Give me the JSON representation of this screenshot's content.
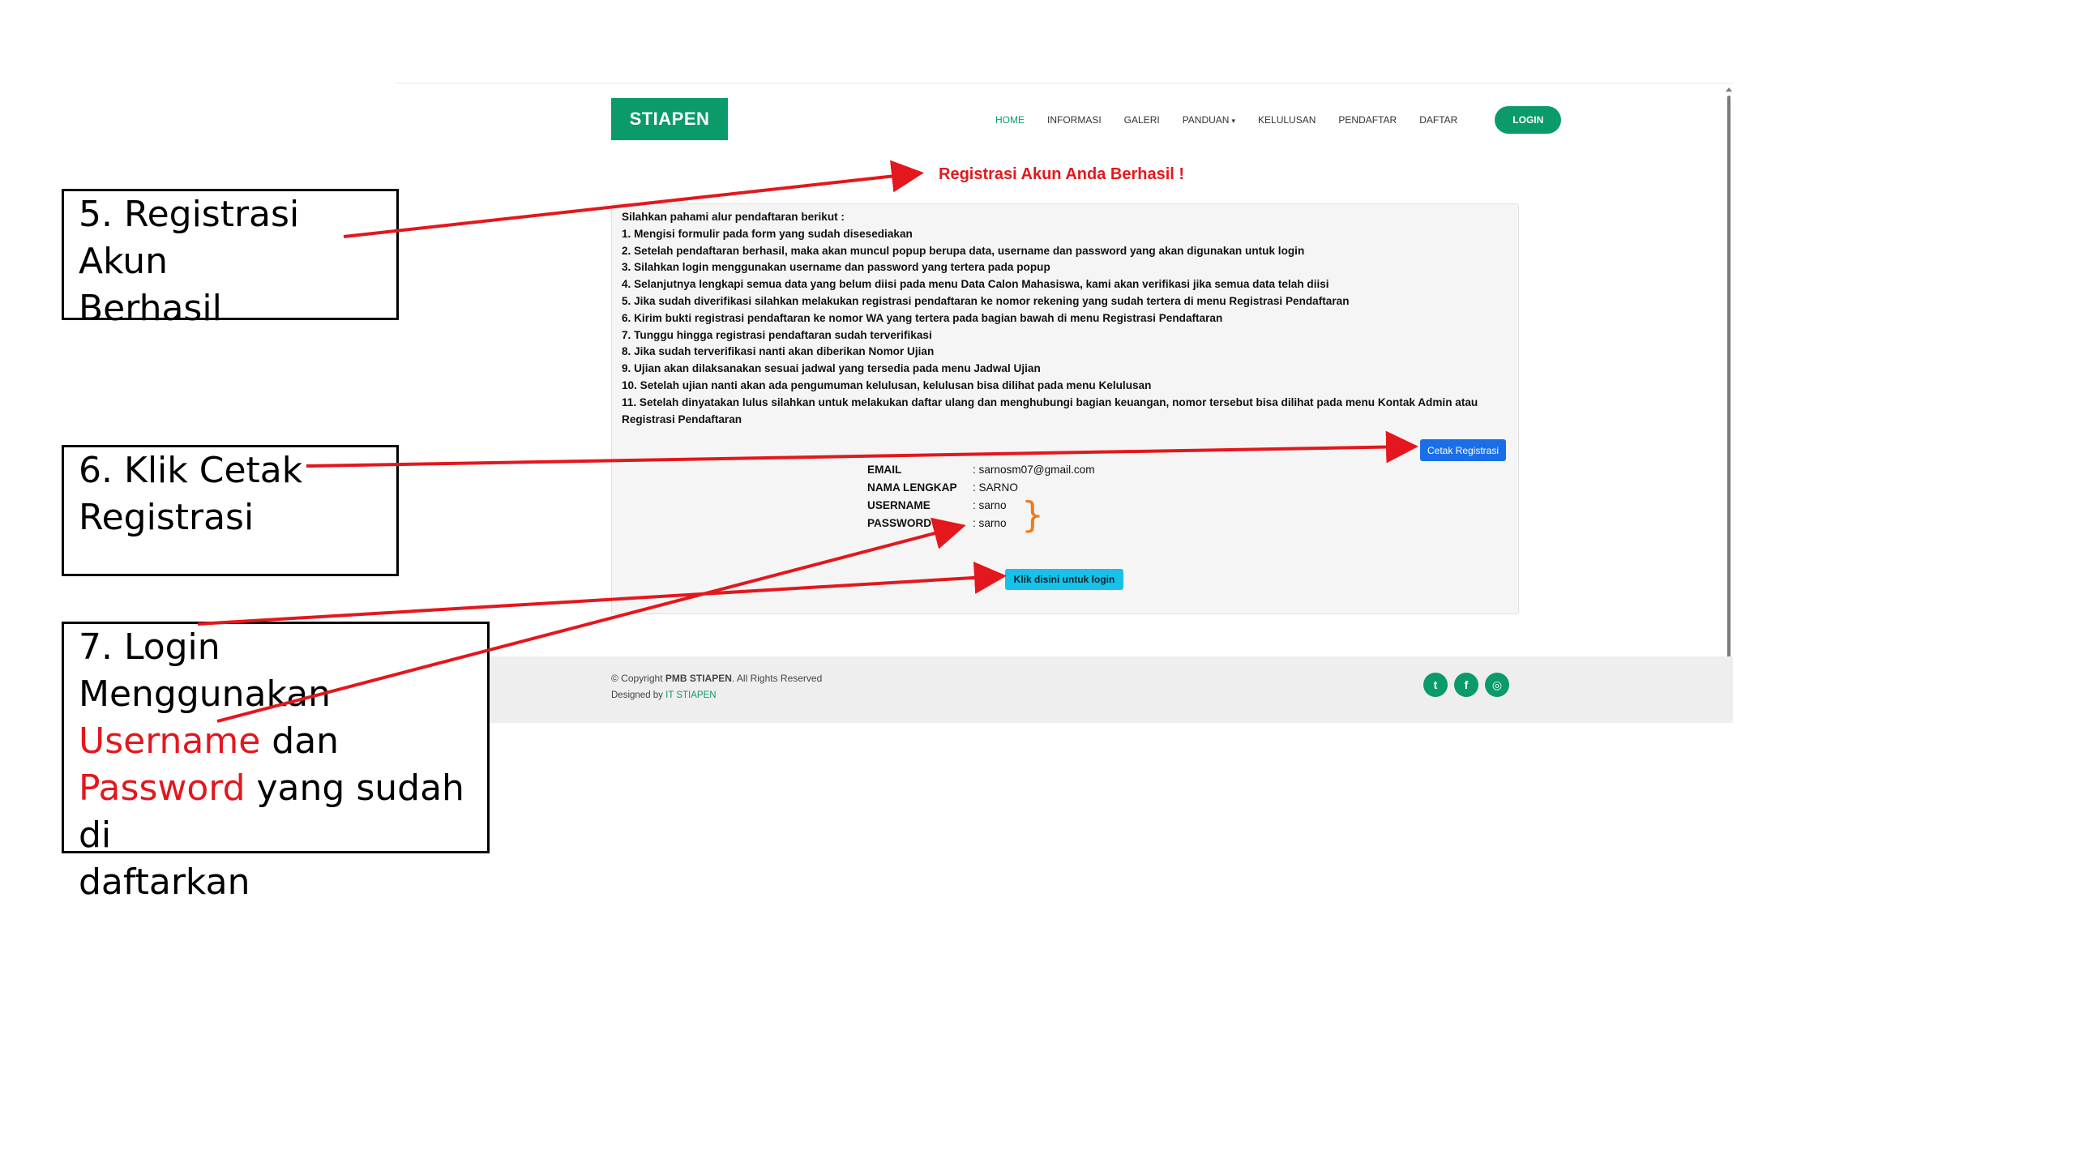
{
  "nav": {
    "logo": "STIAPEN",
    "items": [
      "HOME",
      "INFORMASI",
      "GALERI",
      "PANDUAN",
      "KELULUSAN",
      "PENDAFTAR",
      "DAFTAR"
    ],
    "login_label": "LOGIN",
    "dropdown_caret": "▾"
  },
  "success_title": "Registrasi Akun Anda Berhasil !",
  "instructions": {
    "intro": "Silahkan pahami alur pendaftaran berikut :",
    "steps": [
      "1. Mengisi formulir pada form yang sudah disesediakan",
      "2. Setelah pendaftaran berhasil, maka akan muncul popup berupa data, username dan password yang akan digunakan untuk login",
      "3. Silahkan login menggunakan username dan password yang tertera pada popup",
      "4. Selanjutnya lengkapi semua data yang belum diisi pada menu Data Calon Mahasiswa, kami akan verifikasi jika semua data telah diisi",
      "5. Jika sudah diverifikasi silahkan melakukan registrasi pendaftaran ke nomor rekening yang sudah tertera di menu Registrasi Pendaftaran",
      "6. Kirim bukti registrasi pendaftaran ke nomor WA yang tertera pada bagian bawah di menu Registrasi Pendaftaran",
      "7. Tunggu hingga registrasi pendaftaran sudah terverifikasi",
      "8. Jika sudah terverifikasi nanti akan diberikan Nomor Ujian",
      "9. Ujian akan dilaksanakan sesuai jadwal yang tersedia pada menu Jadwal Ujian",
      "10. Setelah ujian nanti akan ada pengumuman kelulusan, kelulusan bisa dilihat pada menu Kelulusan",
      "11. Setelah dinyatakan lulus silahkan untuk melakukan daftar ulang dan menghubungi bagian keuangan, nomor tersebut bisa dilihat pada menu Kontak Admin atau Registrasi Pendaftaran"
    ]
  },
  "cetak_button": "Cetak Registrasi",
  "credentials": [
    {
      "key": "EMAIL",
      "value": ": sarnosm07@gmail.com"
    },
    {
      "key": "NAMA LENGKAP",
      "value": ": SARNO"
    },
    {
      "key": "USERNAME",
      "value": ": sarno"
    },
    {
      "key": "PASSWORD",
      "value": ": sarno"
    }
  ],
  "login_link_button": "Klik disini untuk login",
  "footer": {
    "copyright_prefix": "© Copyright ",
    "copyright_brand": "PMB STIAPEN",
    "copyright_suffix": ". All Rights Reserved",
    "designed_prefix": "Designed by ",
    "designed_link": "IT STIAPEN",
    "social": [
      {
        "icon": "twitter-icon",
        "glyph": "t"
      },
      {
        "icon": "facebook-icon",
        "glyph": "f"
      },
      {
        "icon": "instagram-icon",
        "glyph": "◎"
      }
    ]
  },
  "annotations": {
    "box5": {
      "line1": "5. Registrasi Akun",
      "line2": "Berhasil"
    },
    "box6": {
      "line1": "6. Klik Cetak",
      "line2": "Registrasi"
    },
    "box7": {
      "line1": "7. Login Menggunakan",
      "username_word": "Username",
      "dan": " dan",
      "password_word": "Password",
      "rest": " yang sudah di",
      "last": "daftarkan"
    }
  },
  "colors": {
    "brand_green": "#0b9a6a",
    "annotation_red": "#e3171d",
    "cetak_blue": "#1a6fe8",
    "login_cyan": "#17c1e8",
    "brace_orange": "#f07a1a"
  }
}
